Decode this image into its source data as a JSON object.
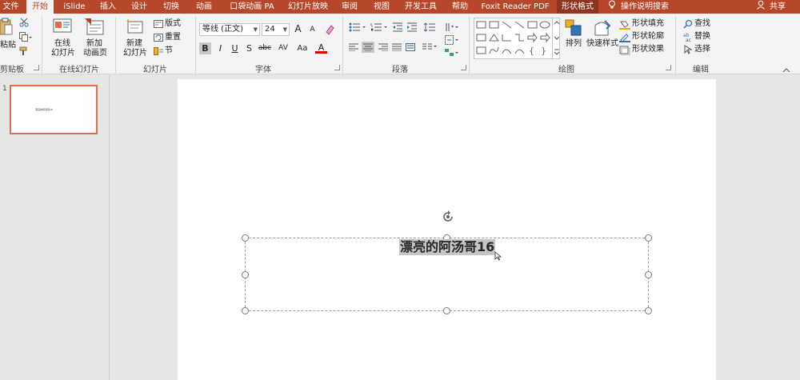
{
  "tabs": [
    "文件",
    "开始",
    "iSlide",
    "插入",
    "设计",
    "切换",
    "动画",
    "口袋动画 PA",
    "幻灯片放映",
    "审阅",
    "视图",
    "开发工具",
    "帮助",
    "Foxit Reader PDF",
    "形状格式"
  ],
  "tellme": "操作说明搜索",
  "share": "共享",
  "colors": {
    "accent": "#b7472a",
    "ribbon_bg": "#f3f3f3",
    "selection": "#e46c4a"
  },
  "clipboard": {
    "paste": "粘贴",
    "label": "剪贴板"
  },
  "online_slides": {
    "btn1_l1": "在线",
    "btn1_l2": "幻灯片",
    "btn2_l1": "新加",
    "btn2_l2": "动画页",
    "label": "在线幻灯片"
  },
  "slides": {
    "new_l1": "新建",
    "new_l2": "幻灯片",
    "layout": "版式",
    "reset": "重置",
    "section": "节",
    "label": "幻灯片"
  },
  "font": {
    "name": "等线 (正文)",
    "size": "24",
    "label": "字体",
    "bold": "B",
    "italic": "I",
    "underline": "U",
    "shadow": "S",
    "strike": "abc",
    "spacing": "AV",
    "case": "Aa",
    "color": "A",
    "grow": "A",
    "shrink": "A"
  },
  "paragraph": {
    "label": "段落"
  },
  "drawing": {
    "arrange": "排列",
    "quick_styles": "快速样式",
    "fill": "形状填充",
    "outline": "形状轮廓",
    "effects": "形状效果",
    "label": "绘图"
  },
  "editing": {
    "find": "查找",
    "replace": "替换",
    "select": "选择",
    "label": "编辑"
  },
  "thumbnail": {
    "number": "1",
    "text": "漂亮的阿汤哥16"
  },
  "slide": {
    "text": "漂亮的阿汤哥16"
  }
}
